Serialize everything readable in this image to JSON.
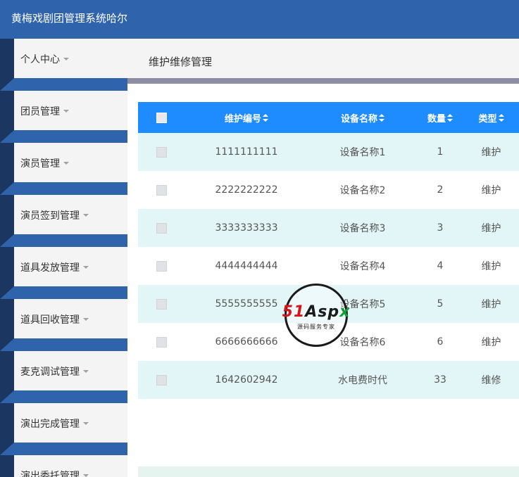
{
  "app": {
    "title": "黄梅戏剧团管理系统哈尔"
  },
  "sidebar": {
    "items": [
      {
        "label": "个人中心"
      },
      {
        "label": "团员管理"
      },
      {
        "label": "演员管理"
      },
      {
        "label": "演员签到管理"
      },
      {
        "label": "道具发放管理"
      },
      {
        "label": "道具回收管理"
      },
      {
        "label": "麦克调试管理"
      },
      {
        "label": "演出完成管理"
      },
      {
        "label": "演出委托管理"
      }
    ]
  },
  "main": {
    "page_title": "维护维修管理"
  },
  "table": {
    "headers": {
      "code": "维护编号",
      "name": "设备名称",
      "qty": "数量",
      "type": "类型"
    },
    "rows": [
      {
        "code": "1111111111",
        "name": "设备名称1",
        "qty": "1",
        "type": "维护"
      },
      {
        "code": "2222222222",
        "name": "设备名称2",
        "qty": "2",
        "type": "维护"
      },
      {
        "code": "3333333333",
        "name": "设备名称3",
        "qty": "3",
        "type": "维护"
      },
      {
        "code": "4444444444",
        "name": "设备名称4",
        "qty": "4",
        "type": "维护"
      },
      {
        "code": "5555555555",
        "name": "设备名称5",
        "qty": "5",
        "type": "维护"
      },
      {
        "code": "6666666666",
        "name": "设备名称6",
        "qty": "6",
        "type": "维护"
      },
      {
        "code": "1642602942",
        "name": "水电费时代",
        "qty": "33",
        "type": "维修"
      }
    ]
  },
  "watermark": {
    "logo_a": "51",
    "logo_b": "Asp",
    "logo_c": "x",
    "sub": "源码服务专家"
  },
  "colors": {
    "header_bg": "#2f64ad",
    "table_head": "#1e8cff",
    "row_alt": "#e3f6f7",
    "rail": "#1a3661"
  }
}
